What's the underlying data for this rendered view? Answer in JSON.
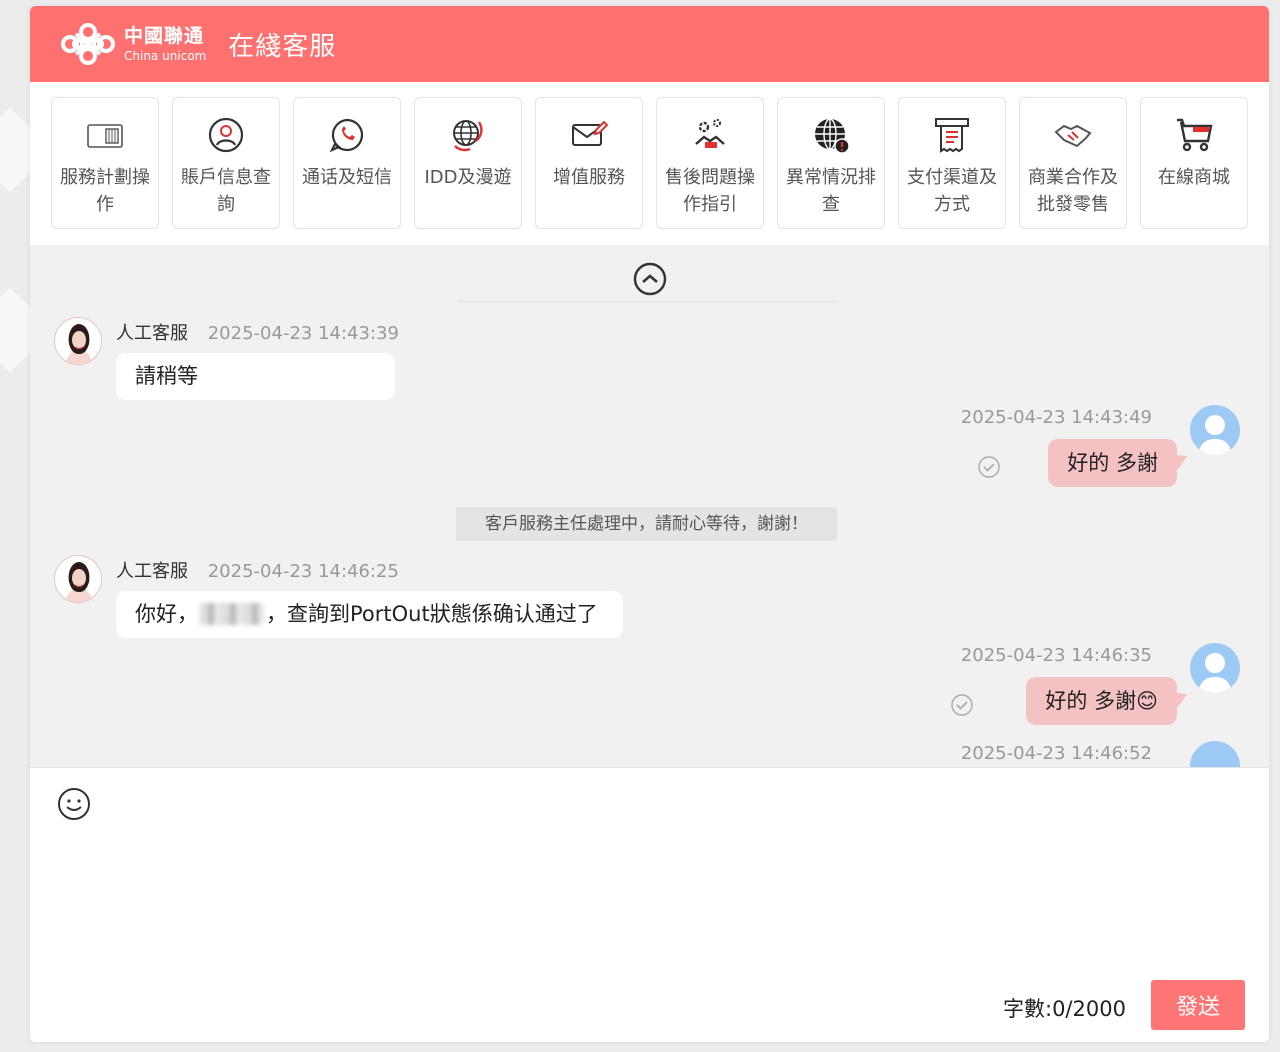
{
  "header": {
    "brand_cn": "中國聯通",
    "brand_en": "China unicom",
    "title": "在綫客服",
    "brand_color": "#ff7070"
  },
  "toolbar": {
    "items": [
      {
        "label": "服務計劃操作",
        "icon": "sim-card-icon"
      },
      {
        "label": "賬戶信息查詢",
        "icon": "user-account-icon"
      },
      {
        "label": "通话及短信",
        "icon": "phone-chat-icon"
      },
      {
        "label": "IDD及漫遊",
        "icon": "globe-roaming-icon"
      },
      {
        "label": "增值服務",
        "icon": "envelope-edit-icon"
      },
      {
        "label": "售後問題操作指引",
        "icon": "gear-handshake-icon"
      },
      {
        "label": "異常情況排查",
        "icon": "globe-alert-icon"
      },
      {
        "label": "支付渠道及方式",
        "icon": "receipt-icon"
      },
      {
        "label": "商業合作及批發零售",
        "icon": "handshake-icon"
      },
      {
        "label": "在線商城",
        "icon": "shopping-cart-icon"
      }
    ]
  },
  "chat": {
    "messages": [
      {
        "side": "left",
        "sender": "人工客服",
        "time": "2025-04-23 14:43:39",
        "text": "請稍等"
      },
      {
        "side": "right",
        "time": "2025-04-23 14:43:49",
        "text": "好的 多謝"
      },
      {
        "side": "system",
        "text": "客戶服務主任處理中，請耐心等待，謝謝！"
      },
      {
        "side": "left",
        "sender": "人工客服",
        "time": "2025-04-23 14:46:25",
        "text_pre": "你好，",
        "text_post": "，查詢到PortOut狀態係确认通过了"
      },
      {
        "side": "right",
        "time": "2025-04-23 14:46:35",
        "text": "好的 多謝😊"
      },
      {
        "side": "right",
        "time": "2025-04-23 14:46:52",
        "text": ""
      }
    ]
  },
  "input": {
    "value": "",
    "char_count": "字數:0/2000",
    "send_label": "發送"
  }
}
